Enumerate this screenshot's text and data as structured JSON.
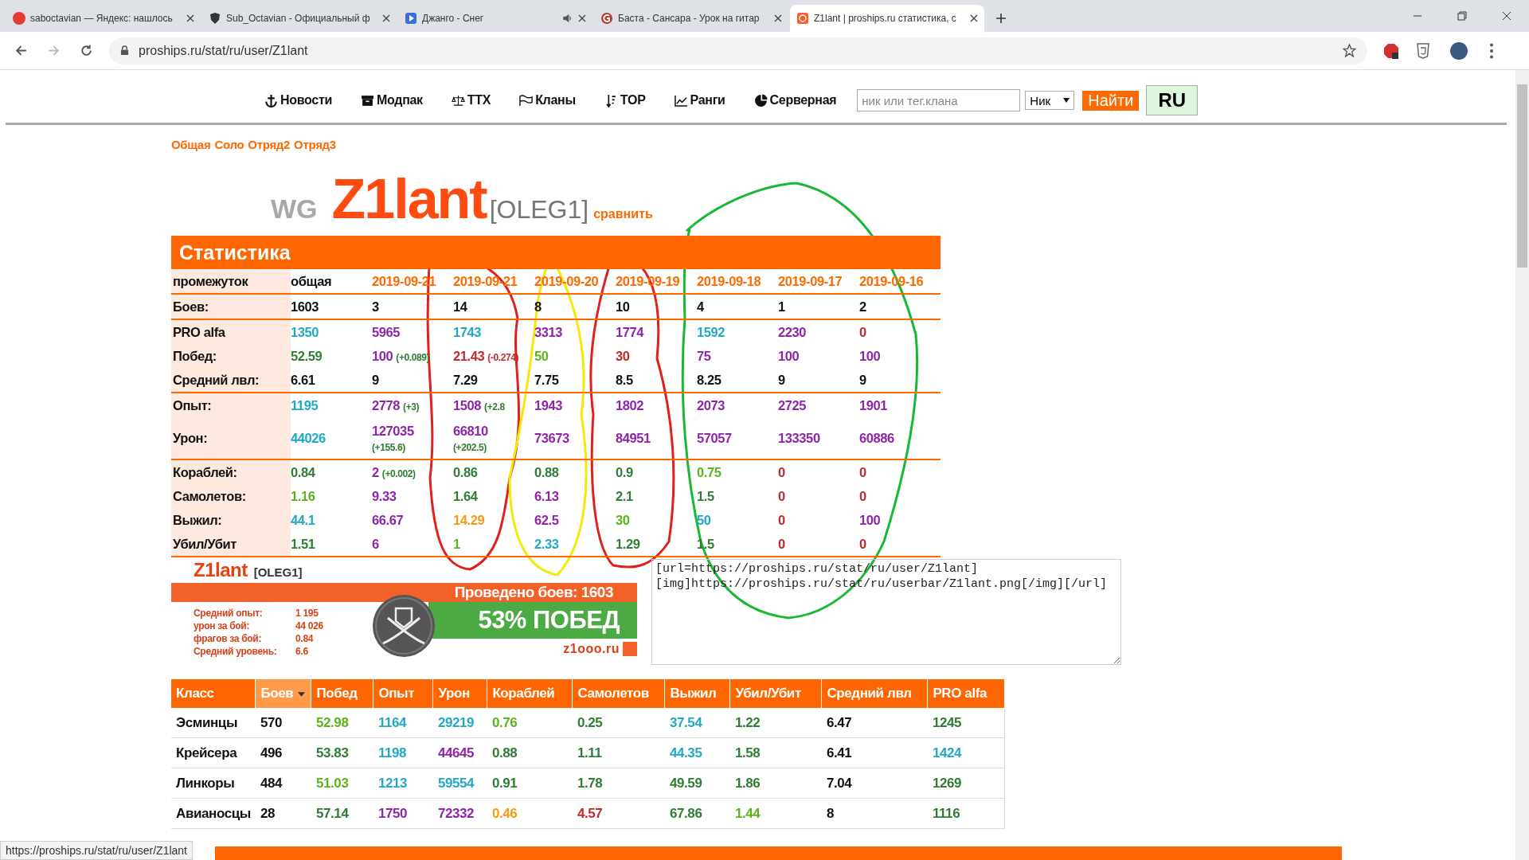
{
  "browser": {
    "tabs": [
      {
        "title": "saboctavian — Яндекс: нашлось",
        "selected": false,
        "audio": false
      },
      {
        "title": "Sub_Octavian - Официальный ф",
        "selected": false,
        "audio": false
      },
      {
        "title": "Джанго - Снег",
        "selected": false,
        "audio": true
      },
      {
        "title": "Баста - Сансара - Урок на гитар",
        "selected": false,
        "audio": false
      },
      {
        "title": "Z1lant | proships.ru статистика, с",
        "selected": true,
        "audio": false
      }
    ],
    "url": "proships.ru/stat/ru/user/Z1lant"
  },
  "nav": {
    "items": [
      "Новости",
      "Модпак",
      "ТТХ",
      "Кланы",
      "TOP",
      "Ранги",
      "Серверная"
    ],
    "search": {
      "placeholder": "ник или тег.клана"
    },
    "select": {
      "value": "Ник"
    },
    "find": "Найти",
    "lang": "RU"
  },
  "modes": [
    "Общая",
    "Соло",
    "Отряд2",
    "Отряд3"
  ],
  "profile": {
    "prefix": "WG",
    "name": "Z1lant",
    "clan": "[OLEG1]",
    "compare": "сравнить"
  },
  "stats": {
    "title": "Статистика",
    "header": {
      "label": "промежуток",
      "columns": [
        {
          "text": "общая",
          "color": "#111111"
        },
        {
          "text": "2019-09-21",
          "color": "#ff6a00"
        },
        {
          "text": "2019-09-21",
          "color": "#ff6a00"
        },
        {
          "text": "2019-09-20",
          "color": "#ff6a00"
        },
        {
          "text": "2019-09-19",
          "color": "#ff6a00"
        },
        {
          "text": "2019-09-18",
          "color": "#ff6a00"
        },
        {
          "text": "2019-09-17",
          "color": "#ff6a00"
        },
        {
          "text": "2019-09-16",
          "color": "#ff6a00"
        }
      ]
    },
    "groups": [
      [
        {
          "label": "Боев:",
          "kind": "line",
          "cells": [
            {
              "text": "1603",
              "color": "#111111"
            },
            {
              "text": "3",
              "color": "#111111"
            },
            {
              "text": "14",
              "color": "#111111"
            },
            {
              "text": "8",
              "color": "#111111"
            },
            {
              "text": "10",
              "color": "#111111"
            },
            {
              "text": "4",
              "color": "#111111"
            },
            {
              "text": "1",
              "color": "#111111"
            },
            {
              "text": "2",
              "color": "#111111"
            }
          ]
        }
      ],
      [
        {
          "label": "PRO alfa",
          "kind": "line",
          "cells": [
            {
              "text": "1350",
              "color": "#1fa9c6"
            },
            {
              "text": "5965",
              "color": "#8e24aa"
            },
            {
              "text": "1743",
              "color": "#1fa9c6"
            },
            {
              "text": "3313",
              "color": "#8e24aa"
            },
            {
              "text": "1774",
              "color": "#8e24aa"
            },
            {
              "text": "1592",
              "color": "#1fa9c6"
            },
            {
              "text": "2230",
              "color": "#8e24aa"
            },
            {
              "text": "0",
              "color": "#c62828"
            }
          ]
        },
        {
          "label": "Побед:",
          "kind": "line",
          "cells": [
            {
              "text": "52.59",
              "color": "#2e7d32"
            },
            {
              "text": "100",
              "color": "#8e24aa",
              "delta": {
                "text": "(+0.089)",
                "color": "#2e7d32"
              }
            },
            {
              "text": "21.43",
              "color": "#c62828",
              "delta": {
                "text": "(-0.274)",
                "color": "#c62828"
              }
            },
            {
              "text": "50",
              "color": "#5bb31a"
            },
            {
              "text": "30",
              "color": "#c62828"
            },
            {
              "text": "75",
              "color": "#8e24aa"
            },
            {
              "text": "100",
              "color": "#8e24aa"
            },
            {
              "text": "100",
              "color": "#8e24aa"
            }
          ]
        },
        {
          "label": "Средний лвл:",
          "kind": "line",
          "cells": [
            {
              "text": "6.61",
              "color": "#111111"
            },
            {
              "text": "9",
              "color": "#111111"
            },
            {
              "text": "7.29",
              "color": "#111111"
            },
            {
              "text": "7.75",
              "color": "#111111"
            },
            {
              "text": "8.5",
              "color": "#111111"
            },
            {
              "text": "8.25",
              "color": "#111111"
            },
            {
              "text": "9",
              "color": "#111111"
            },
            {
              "text": "9",
              "color": "#111111"
            }
          ]
        }
      ],
      [
        {
          "label": "Опыт:",
          "kind": "line",
          "cells": [
            {
              "text": "1195",
              "color": "#1fa9c6"
            },
            {
              "text": "2778",
              "color": "#8e24aa",
              "delta": {
                "text": "(+3)",
                "color": "#2e7d32"
              }
            },
            {
              "text": "1508",
              "color": "#8e24aa",
              "delta": {
                "text": "(+2.8",
                "color": "#2e7d32"
              }
            },
            {
              "text": "1943",
              "color": "#8e24aa"
            },
            {
              "text": "1802",
              "color": "#8e24aa"
            },
            {
              "text": "2073",
              "color": "#8e24aa"
            },
            {
              "text": "2725",
              "color": "#8e24aa"
            },
            {
              "text": "1901",
              "color": "#8e24aa"
            }
          ]
        },
        {
          "label": "Урон:",
          "kind": "stacked",
          "cells": [
            {
              "text": "44026",
              "color": "#1fa9c6"
            },
            {
              "text": "127035",
              "color": "#8e24aa",
              "delta": {
                "text": "(+155.6)",
                "color": "#2e7d32"
              }
            },
            {
              "text": "66810",
              "color": "#8e24aa",
              "delta": {
                "text": "(+202.5)",
                "color": "#2e7d32"
              }
            },
            {
              "text": "73673",
              "color": "#8e24aa"
            },
            {
              "text": "84951",
              "color": "#8e24aa"
            },
            {
              "text": "57057",
              "color": "#8e24aa"
            },
            {
              "text": "133350",
              "color": "#8e24aa"
            },
            {
              "text": "60886",
              "color": "#8e24aa"
            }
          ]
        }
      ],
      [
        {
          "label": "Кораблей:",
          "kind": "line",
          "cells": [
            {
              "text": "0.84",
              "color": "#2e7d32"
            },
            {
              "text": "2",
              "color": "#8e24aa",
              "delta": {
                "text": "(+0.002)",
                "color": "#2e7d32"
              }
            },
            {
              "text": "0.86",
              "color": "#2e7d32"
            },
            {
              "text": "0.88",
              "color": "#2e7d32"
            },
            {
              "text": "0.9",
              "color": "#2e7d32"
            },
            {
              "text": "0.75",
              "color": "#5bb31a"
            },
            {
              "text": "0",
              "color": "#c62828"
            },
            {
              "text": "0",
              "color": "#c62828"
            }
          ]
        },
        {
          "label": "Самолетов:",
          "kind": "line",
          "cells": [
            {
              "text": "1.16",
              "color": "#5bb31a"
            },
            {
              "text": "9.33",
              "color": "#8e24aa"
            },
            {
              "text": "1.64",
              "color": "#2e7d32"
            },
            {
              "text": "6.13",
              "color": "#8e24aa"
            },
            {
              "text": "2.1",
              "color": "#2e7d32"
            },
            {
              "text": "1.5",
              "color": "#2e7d32"
            },
            {
              "text": "0",
              "color": "#c62828"
            },
            {
              "text": "0",
              "color": "#c62828"
            }
          ]
        },
        {
          "label": "Выжил:",
          "kind": "line",
          "cells": [
            {
              "text": "44.1",
              "color": "#1fa9c6"
            },
            {
              "text": "66.67",
              "color": "#8e24aa"
            },
            {
              "text": "14.29",
              "color": "#f39c12"
            },
            {
              "text": "62.5",
              "color": "#8e24aa"
            },
            {
              "text": "30",
              "color": "#5bb31a"
            },
            {
              "text": "50",
              "color": "#1fa9c6"
            },
            {
              "text": "0",
              "color": "#c62828"
            },
            {
              "text": "100",
              "color": "#8e24aa"
            }
          ]
        },
        {
          "label": "Убил/Убит",
          "kind": "line",
          "cells": [
            {
              "text": "1.51",
              "color": "#2e7d32"
            },
            {
              "text": "6",
              "color": "#8e24aa"
            },
            {
              "text": "1",
              "color": "#5bb31a"
            },
            {
              "text": "2.33",
              "color": "#1fa9c6"
            },
            {
              "text": "1.29",
              "color": "#2e7d32"
            },
            {
              "text": "1.5",
              "color": "#2e7d32"
            },
            {
              "text": "0",
              "color": "#c62828"
            },
            {
              "text": "0",
              "color": "#c62828"
            }
          ]
        }
      ]
    ]
  },
  "userbar": {
    "name": "Z1lant",
    "clan": "[OLEG1]",
    "battles": "Проведено боев: 1603",
    "stats": [
      {
        "label": "Средний опыт:",
        "value": "1 195"
      },
      {
        "label": "урон за бой:",
        "value": "44 026"
      },
      {
        "label": "фрагов за бой:",
        "value": "0.84"
      },
      {
        "label": "Средний уровень:",
        "value": "6.6"
      }
    ],
    "wins": "53% ПОБЕД",
    "site": "z1ooo.ru"
  },
  "embed_code": {
    "value": "[url=https://proships.ru/stat/ru/user/Z1lant]\n[img]https://proships.ru/stat/ru/userbar/Z1lant.png[/img][/url]"
  },
  "class_table": {
    "columns": [
      {
        "label": "Класс",
        "selected": false
      },
      {
        "label": "Боев",
        "selected": true
      },
      {
        "label": "Побед",
        "selected": false
      },
      {
        "label": "Опыт",
        "selected": false
      },
      {
        "label": "Урон",
        "selected": false
      },
      {
        "label": "Кораблей",
        "selected": false
      },
      {
        "label": "Самолетов",
        "selected": false
      },
      {
        "label": "Выжил",
        "selected": false
      },
      {
        "label": "Убил/Убит",
        "selected": false
      },
      {
        "label": "Средний лвл",
        "selected": false
      },
      {
        "label": "PRO alfa",
        "selected": false
      }
    ],
    "rows": [
      {
        "cells": [
          {
            "text": "Эсминцы",
            "color": "#111111"
          },
          {
            "text": "570",
            "color": "#111111"
          },
          {
            "text": "52.98",
            "color": "#5bb31a"
          },
          {
            "text": "1164",
            "color": "#1fa9c6"
          },
          {
            "text": "29219",
            "color": "#1fa9c6"
          },
          {
            "text": "0.76",
            "color": "#5bb31a"
          },
          {
            "text": "0.25",
            "color": "#2e7d32"
          },
          {
            "text": "37.54",
            "color": "#1fa9c6"
          },
          {
            "text": "1.22",
            "color": "#2e7d32"
          },
          {
            "text": "6.47",
            "color": "#111111"
          },
          {
            "text": "1245",
            "color": "#2e7d32"
          }
        ]
      },
      {
        "cells": [
          {
            "text": "Крейсера",
            "color": "#111111"
          },
          {
            "text": "496",
            "color": "#111111"
          },
          {
            "text": "53.83",
            "color": "#2e7d32"
          },
          {
            "text": "1198",
            "color": "#1fa9c6"
          },
          {
            "text": "44645",
            "color": "#8e24aa"
          },
          {
            "text": "0.88",
            "color": "#2e7d32"
          },
          {
            "text": "1.11",
            "color": "#2e7d32"
          },
          {
            "text": "44.35",
            "color": "#1fa9c6"
          },
          {
            "text": "1.58",
            "color": "#2e7d32"
          },
          {
            "text": "6.41",
            "color": "#111111"
          },
          {
            "text": "1424",
            "color": "#1fa9c6"
          }
        ]
      },
      {
        "cells": [
          {
            "text": "Линкоры",
            "color": "#111111"
          },
          {
            "text": "484",
            "color": "#111111"
          },
          {
            "text": "51.03",
            "color": "#5bb31a"
          },
          {
            "text": "1213",
            "color": "#1fa9c6"
          },
          {
            "text": "59554",
            "color": "#1fa9c6"
          },
          {
            "text": "0.91",
            "color": "#2e7d32"
          },
          {
            "text": "1.78",
            "color": "#2e7d32"
          },
          {
            "text": "49.59",
            "color": "#2e7d32"
          },
          {
            "text": "1.86",
            "color": "#2e7d32"
          },
          {
            "text": "7.04",
            "color": "#111111"
          },
          {
            "text": "1269",
            "color": "#2e7d32"
          }
        ]
      },
      {
        "cells": [
          {
            "text": "Авианосцы",
            "color": "#111111"
          },
          {
            "text": "28",
            "color": "#111111"
          },
          {
            "text": "57.14",
            "color": "#2e7d32"
          },
          {
            "text": "1750",
            "color": "#8e24aa"
          },
          {
            "text": "72332",
            "color": "#8e24aa"
          },
          {
            "text": "0.46",
            "color": "#f39c12"
          },
          {
            "text": "4.57",
            "color": "#c62828"
          },
          {
            "text": "67.86",
            "color": "#2e7d32"
          },
          {
            "text": "1.44",
            "color": "#5bb31a"
          },
          {
            "text": "8",
            "color": "#111111"
          },
          {
            "text": "1116",
            "color": "#2e7d32"
          }
        ]
      }
    ]
  },
  "status_url": "https://proships.ru/stat/ru/user/Z1lant"
}
